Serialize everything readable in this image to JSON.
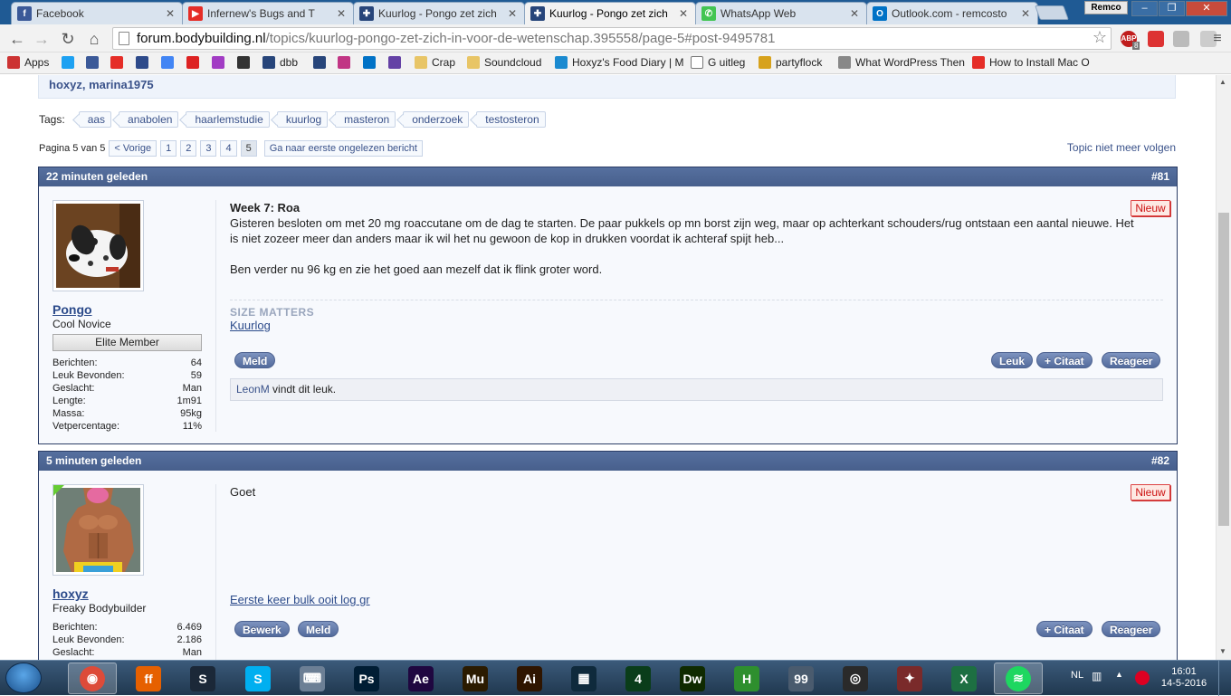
{
  "browser": {
    "tabs": [
      {
        "title": "Facebook",
        "icon": "facebook-icon",
        "color": "#3b5998",
        "glyph": "f"
      },
      {
        "title": "Infernew's Bugs and T",
        "icon": "youtube-icon",
        "color": "#e52d27",
        "glyph": "▶"
      },
      {
        "title": "Kuurlog - Pongo zet zich",
        "icon": "bodybuilding-icon",
        "color": "#27457a",
        "glyph": "✚"
      },
      {
        "title": "Kuurlog - Pongo zet zich",
        "icon": "bodybuilding-icon",
        "color": "#27457a",
        "glyph": "✚"
      },
      {
        "title": "WhatsApp Web",
        "icon": "whatsapp-icon",
        "color": "#43c553",
        "glyph": "✆"
      },
      {
        "title": "Outlook.com - remcosto",
        "icon": "outlook-icon",
        "color": "#0072c6",
        "glyph": "O"
      }
    ],
    "active_tab": 3,
    "profile": "Remco",
    "url_host": "forum.bodybuilding.nl",
    "url_path": "/topics/kuurlog-pongo-zet-zich-in-voor-de-wetenschap.395558/page-5#post-9495781",
    "adblock_badge": "ABP",
    "adblock_count": "8",
    "bookmarks": [
      {
        "label": "Apps",
        "icon": "apps-icon"
      },
      {
        "label": "",
        "icon": "twitter-icon"
      },
      {
        "label": "",
        "icon": "facebook-icon"
      },
      {
        "label": "",
        "icon": "youtube-icon"
      },
      {
        "label": "",
        "icon": "af-icon"
      },
      {
        "label": "",
        "icon": "google-icon"
      },
      {
        "label": "",
        "icon": "d-icon"
      },
      {
        "label": "",
        "icon": "purple-icon"
      },
      {
        "label": "",
        "icon": "dark-icon"
      },
      {
        "label": "dbb",
        "icon": "bodybuilding-icon"
      },
      {
        "label": "",
        "icon": "bodybuilding-icon"
      },
      {
        "label": "",
        "icon": "instagram-icon"
      },
      {
        "label": "",
        "icon": "outlook-icon"
      },
      {
        "label": "",
        "icon": "twitch-icon"
      },
      {
        "label": "Crap",
        "icon": "folder-icon"
      },
      {
        "label": "Soundcloud",
        "icon": "folder-icon"
      },
      {
        "label": "Hoxyz's Food Diary | M",
        "icon": "food-icon"
      },
      {
        "label": "G uitleg",
        "icon": "page-icon"
      },
      {
        "label": "partyflock",
        "icon": "partyflock-icon"
      },
      {
        "label": "What WordPress Then",
        "icon": "search-icon"
      },
      {
        "label": "How to Install Mac O",
        "icon": "youtube-icon"
      }
    ]
  },
  "page": {
    "participants": "hoxyz, marina1975",
    "tags_label": "Tags:",
    "tags": [
      "aas",
      "anabolen",
      "haarlemstudie",
      "kuurlog",
      "masteron",
      "onderzoek",
      "testosteron"
    ],
    "pager_label": "Pagina 5 van 5",
    "pager_prev": "< Vorige",
    "pages": [
      "1",
      "2",
      "3",
      "4",
      "5"
    ],
    "current_page": "5",
    "goto_unread": "Ga naar eerste ongelezen bericht",
    "unfollow": "Topic niet meer volgen"
  },
  "posts": [
    {
      "time": "22 minuten geleden",
      "number": "#81",
      "username": "Pongo",
      "user_title": "Cool Novice",
      "rank": "Elite Member",
      "stats": [
        {
          "label": "Berichten:",
          "value": "64"
        },
        {
          "label": "Leuk Bevonden:",
          "value": "59"
        },
        {
          "label": "Geslacht:",
          "value": "Man"
        },
        {
          "label": "Lengte:",
          "value": "1m91"
        },
        {
          "label": "Massa:",
          "value": "95kg"
        },
        {
          "label": "Vetpercentage:",
          "value": "11%"
        }
      ],
      "new_label": "Nieuw",
      "title": "Week 7: Roa",
      "body1": "Gisteren besloten om met 20 mg roaccutane om de dag te starten. De paar pukkels op mn borst zijn weg, maar op achterkant schouders/rug ontstaan een aantal nieuwe. Het is niet zozeer meer dan anders maar ik wil het nu gewoon de kop in drukken voordat ik achteraf spijt heb...",
      "body2": "Ben verder nu 96 kg en zie het goed aan mezelf dat ik flink groter word.",
      "sig_heading": "SIZE MATTERS",
      "sig_link": "Kuurlog",
      "btn_report": "Meld",
      "btn_like": "Leuk",
      "btn_quote": "+ Citaat",
      "btn_reply": "Reageer",
      "liked_by": "LeonM",
      "liked_text": " vindt dit leuk."
    },
    {
      "time": "5 minuten geleden",
      "number": "#82",
      "username": "hoxyz",
      "user_title": "Freaky Bodybuilder",
      "stats": [
        {
          "label": "Berichten:",
          "value": "6.469"
        },
        {
          "label": "Leuk Bevonden:",
          "value": "2.186"
        },
        {
          "label": "Geslacht:",
          "value": "Man"
        }
      ],
      "new_label": "Nieuw",
      "body": "Goet",
      "sig_link": "Eerste keer bulk ooit log gr",
      "btn_edit": "Bewerk",
      "btn_report": "Meld",
      "btn_quote": "+ Citaat",
      "btn_reply": "Reageer"
    }
  ],
  "taskbar": {
    "apps": [
      {
        "name": "chrome-icon",
        "color": "#dd4b39",
        "glyph": "◉"
      },
      {
        "name": "firefox-icon",
        "color": "#e66000",
        "glyph": "ff"
      },
      {
        "name": "steam-icon",
        "color": "#1b2838",
        "glyph": "S"
      },
      {
        "name": "skype-icon",
        "color": "#00aff0",
        "glyph": "S"
      },
      {
        "name": "keyboard-icon",
        "color": "#6c7f95",
        "glyph": "⌨"
      },
      {
        "name": "photoshop-icon",
        "color": "#001d34",
        "glyph": "Ps"
      },
      {
        "name": "after-effects-icon",
        "color": "#1f0740",
        "glyph": "Ae"
      },
      {
        "name": "muse-icon",
        "color": "#2b1b00",
        "glyph": "Mu"
      },
      {
        "name": "illustrator-icon",
        "color": "#2f1500",
        "glyph": "Ai"
      },
      {
        "name": "video-editor-icon",
        "color": "#0f2a3c",
        "glyph": "▦"
      },
      {
        "name": "camtasia-icon",
        "color": "#0a3d1a",
        "glyph": "4"
      },
      {
        "name": "dreamweaver-icon",
        "color": "#0f2a00",
        "glyph": "Dw"
      },
      {
        "name": "h-app-icon",
        "color": "#2e8f2e",
        "glyph": "H"
      },
      {
        "name": "laptop-icon",
        "color": "#4a5b6e",
        "glyph": "99"
      },
      {
        "name": "steering-icon",
        "color": "#2a2a2a",
        "glyph": "◎"
      },
      {
        "name": "game-icon",
        "color": "#7a2a2a",
        "glyph": "✦"
      },
      {
        "name": "excel-icon",
        "color": "#1d6f42",
        "glyph": "X"
      },
      {
        "name": "spotify-icon",
        "color": "#1ed760",
        "glyph": "≋"
      }
    ],
    "lang": "NL",
    "time": "16:01",
    "date": "14-5-2016"
  }
}
